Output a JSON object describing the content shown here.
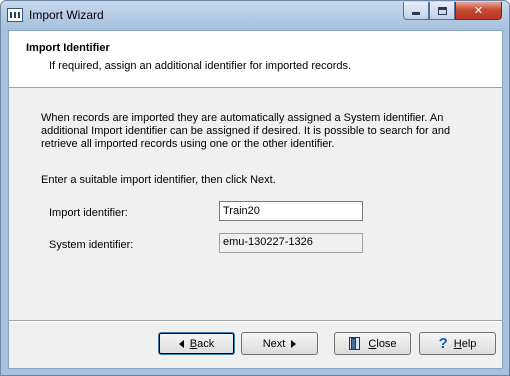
{
  "window": {
    "title": "Import Wizard"
  },
  "header": {
    "title": "Import Identifier",
    "subtitle": "If required, assign an additional identifier for imported records."
  },
  "body": {
    "paragraph": "When records are imported they are automatically assigned a System identifier. An additional Import identifier can be assigned if desired. It is possible to search for and retrieve all imported records using one or the other identifier.",
    "instruction": "Enter a suitable import identifier, then click Next."
  },
  "form": {
    "import_label": "Import identifier:",
    "import_value": "Train20",
    "system_label": "System identifier:",
    "system_value": "emu-130227-1326"
  },
  "buttons": {
    "back_mnemonic": "B",
    "back_rest": "ack",
    "next_label": "Next",
    "close_mnemonic": "C",
    "close_rest": "lose",
    "help_mnemonic": "H",
    "help_rest": "elp"
  },
  "icons": {
    "app": "wizard-film-icon",
    "minimize": "minimize-icon",
    "maximize": "maximize-icon",
    "close": "close-icon",
    "back": "triangle-left-icon",
    "next": "triangle-right-icon",
    "close_button": "door-exit-icon",
    "help": "question-mark-icon"
  },
  "colors": {
    "titlebar_close": "#c74a33",
    "help_icon": "#1558c2",
    "dialog_bg": "#f0f0f0"
  }
}
